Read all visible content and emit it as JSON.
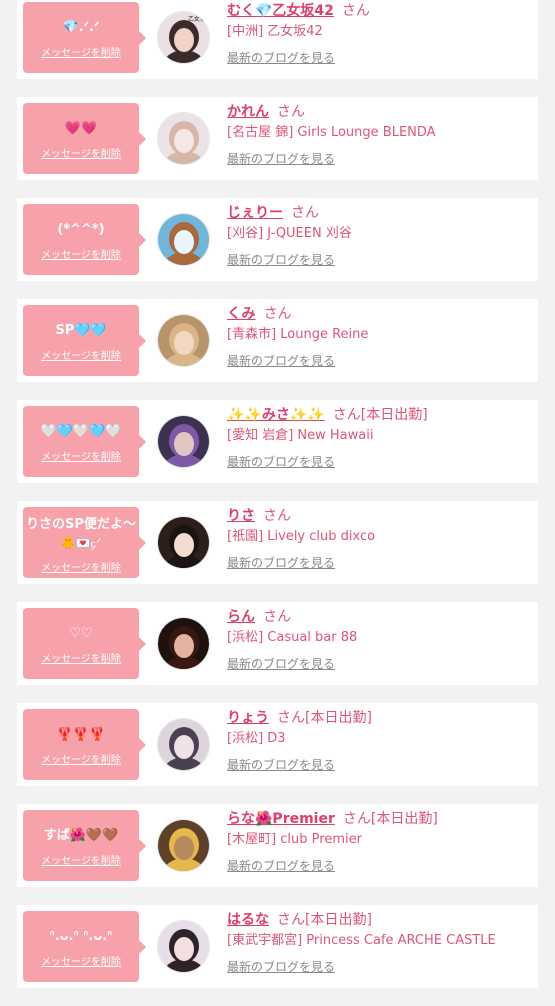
{
  "delete_label": "メッセージを削除",
  "blog_label": "最新のブログを見る",
  "san_label": "さん",
  "colors": {
    "bubble": "#f7a1ab",
    "name": "#e03d6a",
    "shop": "#e05577",
    "link": "#8a8a8a"
  },
  "entries": [
    {
      "msg": "💎.ᐟ.ᐟ",
      "name": "むく💎乙女坂42",
      "shift": "",
      "shop": "[中洲] 乙女坂42",
      "avatar": {
        "bg": "#e8e0e2",
        "c1": "#3a2a2a",
        "c2": "#f1d3c6",
        "label": "乙女坂42"
      }
    },
    {
      "msg": "💗💗",
      "name": "かれん",
      "shift": "",
      "shop": "[名古屋 錦] Girls Lounge BLENDA",
      "avatar": {
        "bg": "#e9e3e6",
        "c1": "#d6b7a7",
        "c2": "#f5e7e6",
        "label": ""
      }
    },
    {
      "msg": "(*^^*)",
      "name": "じぇりー",
      "shift": "",
      "shop": "[刈谷] J-QUEEN 刈谷",
      "avatar": {
        "bg": "#6fb6da",
        "c1": "#a86a3c",
        "c2": "#e8f4fb",
        "label": ""
      }
    },
    {
      "msg": "SP🩵🩵",
      "name": "くみ",
      "shift": "",
      "shop": "[青森市] Lounge Reine",
      "avatar": {
        "bg": "#b8946b",
        "c1": "#d9b588",
        "c2": "#f2d7c2",
        "label": ""
      }
    },
    {
      "msg": "🤍🩵🤍🩵🤍",
      "name": "✨✨みさ✨✨",
      "shift": "[本日出勤]",
      "shop": "[愛知 岩倉] New Hawaii",
      "avatar": {
        "bg": "#3c3150",
        "c1": "#7d5aa6",
        "c2": "#e0c7c1",
        "label": ""
      }
    },
    {
      "msg": "りさのSP便だよ〜",
      "msg2": "🐥💌᧔ᐟ",
      "name": "りさ",
      "shift": "",
      "shop": "[祇園] Lively club dixco",
      "avatar": {
        "bg": "#2b1e1b",
        "c1": "#1c1412",
        "c2": "#f3dccf",
        "label": ""
      }
    },
    {
      "msg": "♡♡",
      "name": "らん",
      "shift": "",
      "shop": "[浜松] Casual bar 88",
      "avatar": {
        "bg": "#1e1211",
        "c1": "#3a1812",
        "c2": "#e2b39f",
        "label": ""
      }
    },
    {
      "msg": "🦞🦞🦞",
      "name": "りょう",
      "shift": "[本日出勤]",
      "shop": "[浜松] D3",
      "avatar": {
        "bg": "#dcd6dc",
        "c1": "#4b3f52",
        "c2": "#efe0e6",
        "label": ""
      }
    },
    {
      "msg": "すば🌺🤎🤎",
      "name": "らな🌺Premier",
      "shift": "[本日出勤]",
      "shop": "[木屋町] club Premier",
      "avatar": {
        "bg": "#5d4128",
        "c1": "#e7b64d",
        "c2": "#b58b5c",
        "label": ""
      }
    },
    {
      "msg": "ᐢ.ᴗ.ᐢ ᐢ.ᴗ.ᐢ",
      "name": "はるな",
      "shift": "[本日出勤]",
      "shop": "[東武宇都宮] Princess Cafe ARCHE CASTLE",
      "avatar": {
        "bg": "#e7dfe8",
        "c1": "#2e2327",
        "c2": "#f4dfe3",
        "label": ""
      }
    }
  ]
}
